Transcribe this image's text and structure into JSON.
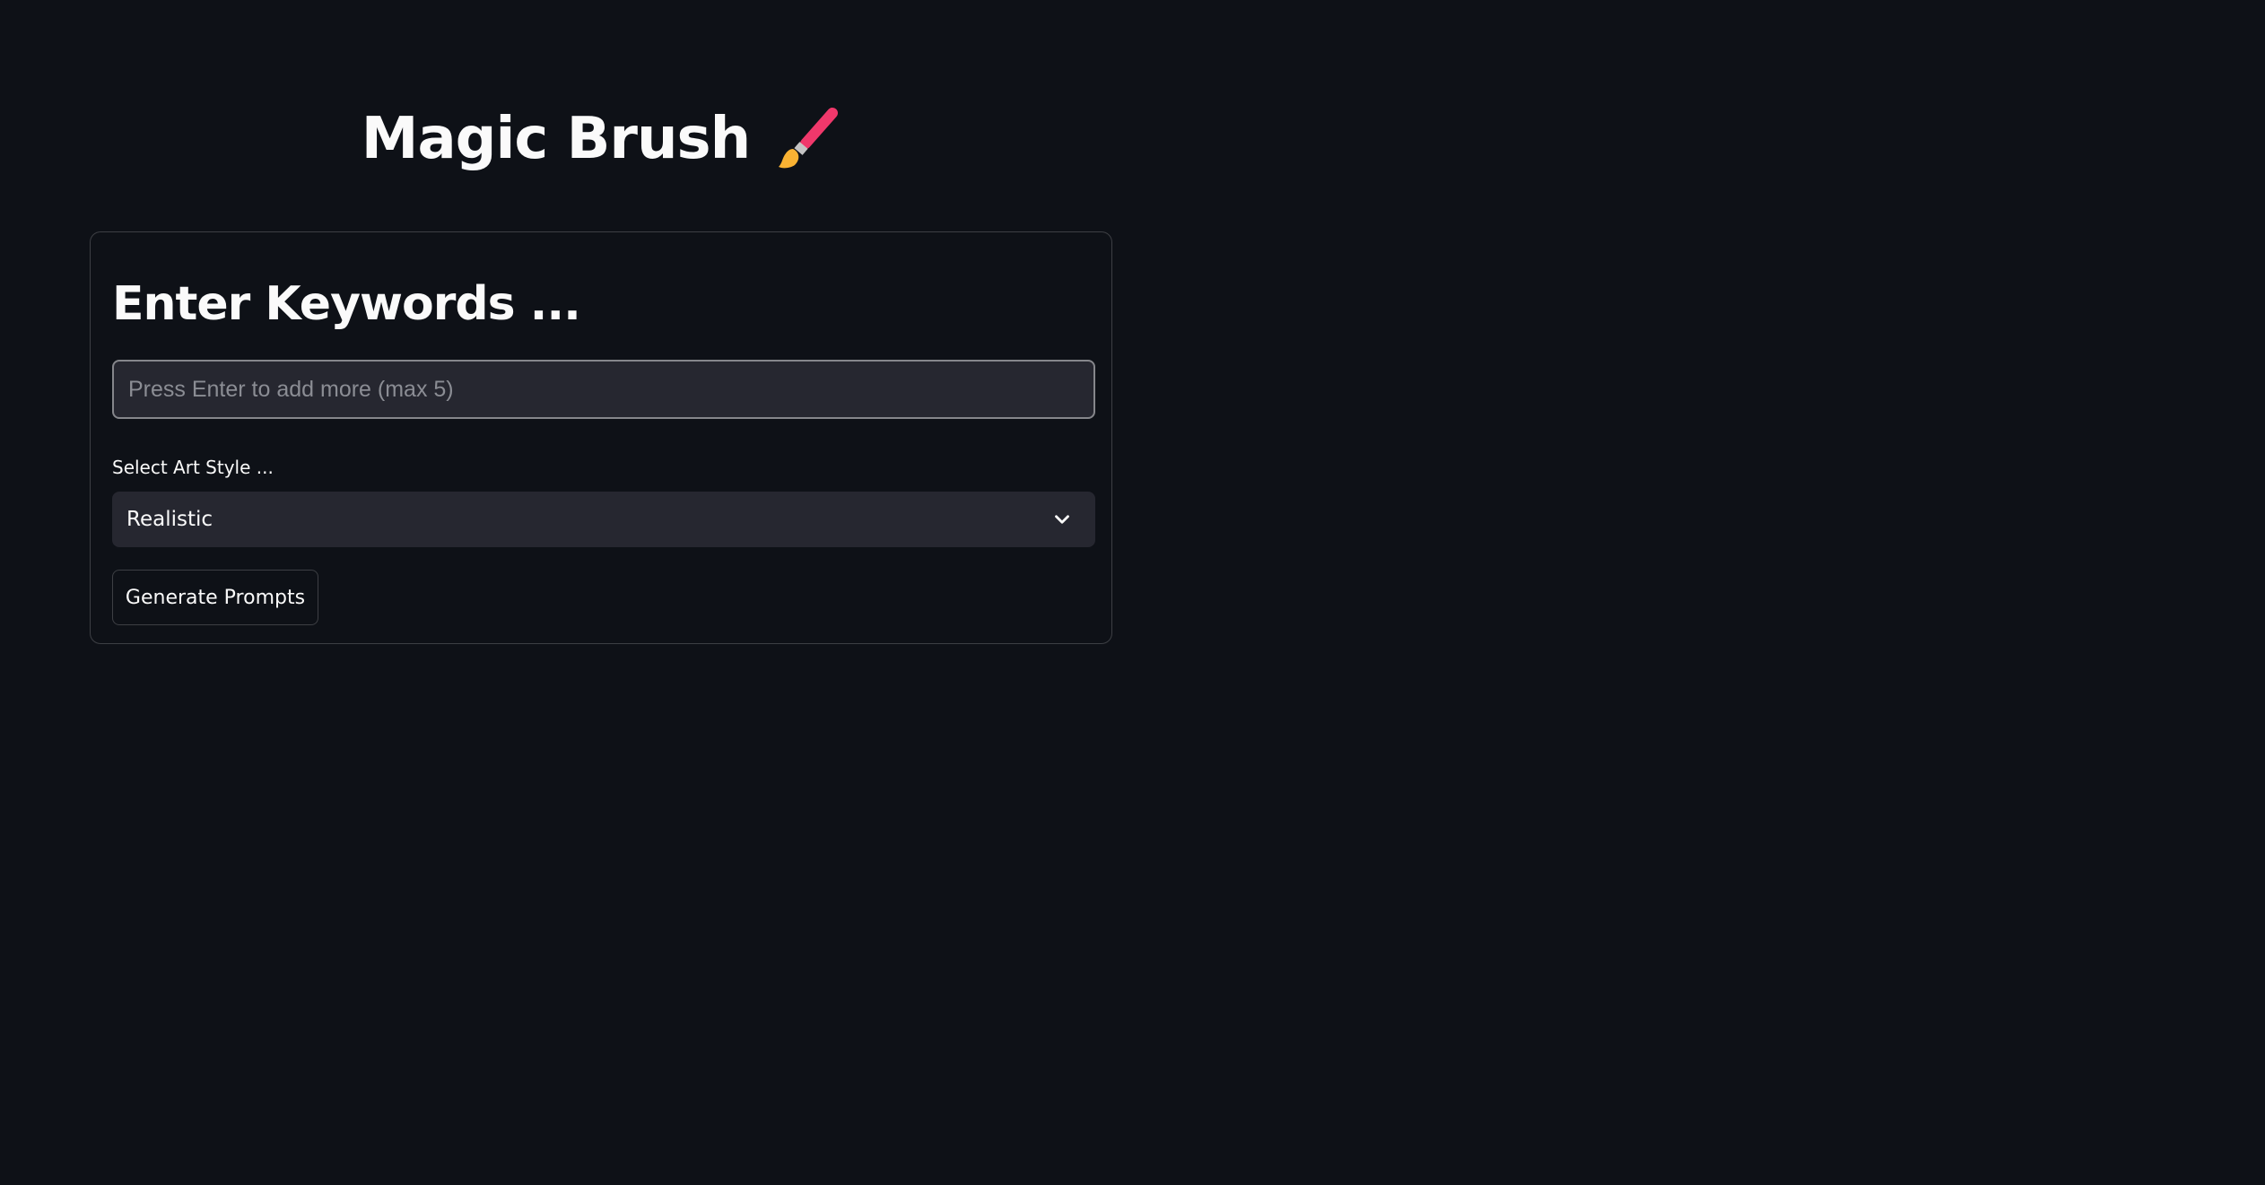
{
  "header": {
    "title": "Magic Brush",
    "title_icon": "paintbrush-icon"
  },
  "form": {
    "heading": "Enter Keywords ...",
    "keywords_input": {
      "value": "",
      "placeholder": "Press Enter to add more (max 5)"
    },
    "art_style": {
      "label": "Select Art Style ...",
      "selected": "Realistic",
      "icon": "chevron-down-icon"
    },
    "generate_button_label": "Generate Prompts"
  },
  "colors": {
    "background": "#0e1117",
    "input_background": "#262730",
    "text": "#fafafa",
    "brush_handle": "#f0386b",
    "brush_tip": "#f9b233"
  }
}
